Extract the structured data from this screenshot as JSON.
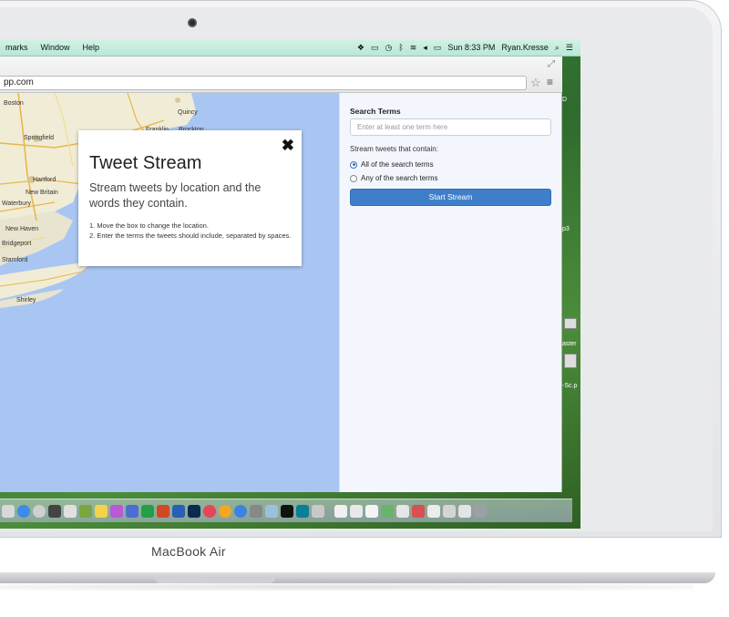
{
  "menubar": {
    "items": [
      "marks",
      "Window",
      "Help"
    ],
    "time": "Sun 8:33 PM",
    "user": "Ryan.Kresse"
  },
  "browser": {
    "url": "pp.com"
  },
  "map": {
    "labels": [
      "Boston",
      "Quincy",
      "Franklin",
      "Brockton",
      "Springfield",
      "Hartford",
      "New Britain",
      "Waterbury",
      "New Haven",
      "Stamford",
      "Shirley",
      "Bridgeport"
    ]
  },
  "card": {
    "title": "Tweet Stream",
    "subtitle": "Stream tweets by location and the words they contain.",
    "step1": "1. Move the box to change the location.",
    "step2": "2. Enter the terms the tweets should include, separated by spaces."
  },
  "panel": {
    "search_terms_label": "Search Terms",
    "search_placeholder": "Enter at least one term here",
    "contain_label": "Stream tweets that contain:",
    "option_all": "All of the search terms",
    "option_any": "Any of the search terms",
    "start_button": "Start Stream"
  },
  "desktop": {
    "side_labels": [
      "D",
      "p3",
      "aster",
      "-Sc.p"
    ]
  },
  "device": {
    "brand": "MacBook Air"
  },
  "colors": {
    "map_water": "#a9c6f2",
    "button": "#3f7fc9",
    "menubar": "#c4eedf"
  }
}
